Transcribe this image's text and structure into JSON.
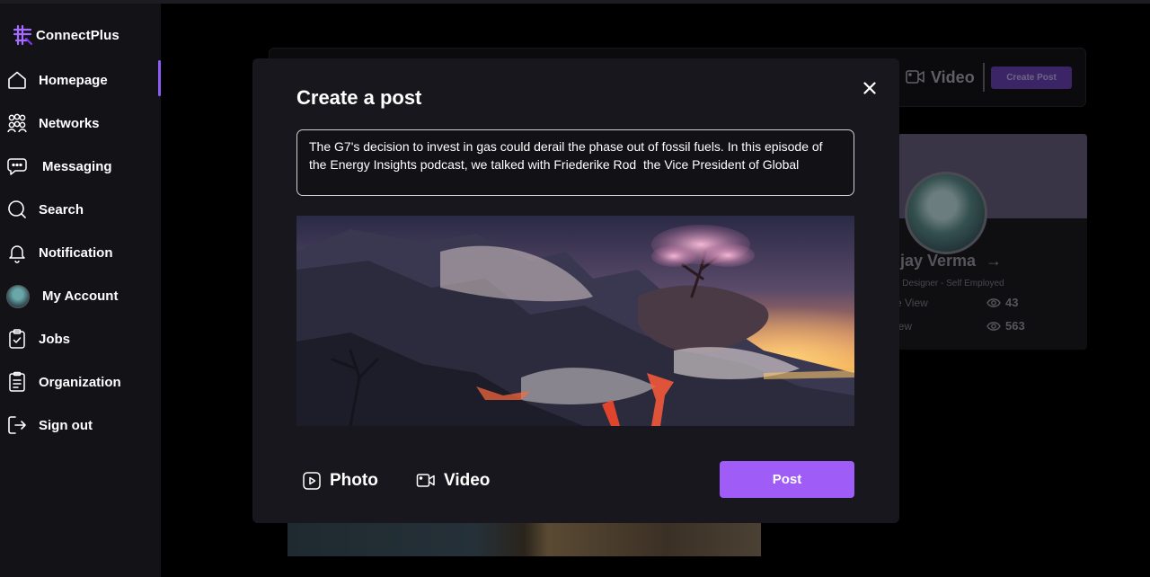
{
  "app": {
    "name": "ConnectPlus"
  },
  "sidebar": {
    "items": [
      {
        "label": "Homepage",
        "icon": "home-icon",
        "active": true
      },
      {
        "label": "Networks",
        "icon": "network-icon"
      },
      {
        "label": "Messaging",
        "icon": "chat-icon"
      },
      {
        "label": "Search",
        "icon": "search-icon"
      },
      {
        "label": "Notification",
        "icon": "bell-icon"
      },
      {
        "label": "My Account",
        "icon": "avatar"
      },
      {
        "label": "Jobs",
        "icon": "clipboard-check-icon"
      },
      {
        "label": "Organization",
        "icon": "document-icon"
      },
      {
        "label": "Sign out",
        "icon": "sign-out-icon"
      }
    ]
  },
  "background": {
    "composer": {
      "video_label": "Video",
      "create_post_label": "Create Post"
    },
    "profile": {
      "name": "ijay Verma",
      "role": "ll Designer - Self Employed",
      "stats": [
        {
          "label": "e View",
          "value": "43"
        },
        {
          "label": "iew",
          "value": "563"
        }
      ]
    }
  },
  "modal": {
    "title": "Create a post",
    "text_value": "The G7's decision to invest in gas could derail the phase out of fossil fuels. In this episode of the Energy Insights podcast, we talked with Friederike Rod  the Vice President of Global",
    "photo_label": "Photo",
    "video_label": "Video",
    "post_label": "Post"
  },
  "colors": {
    "accent": "#9f5cf6",
    "sidebar_bg": "#121217",
    "modal_bg": "#18171d"
  }
}
